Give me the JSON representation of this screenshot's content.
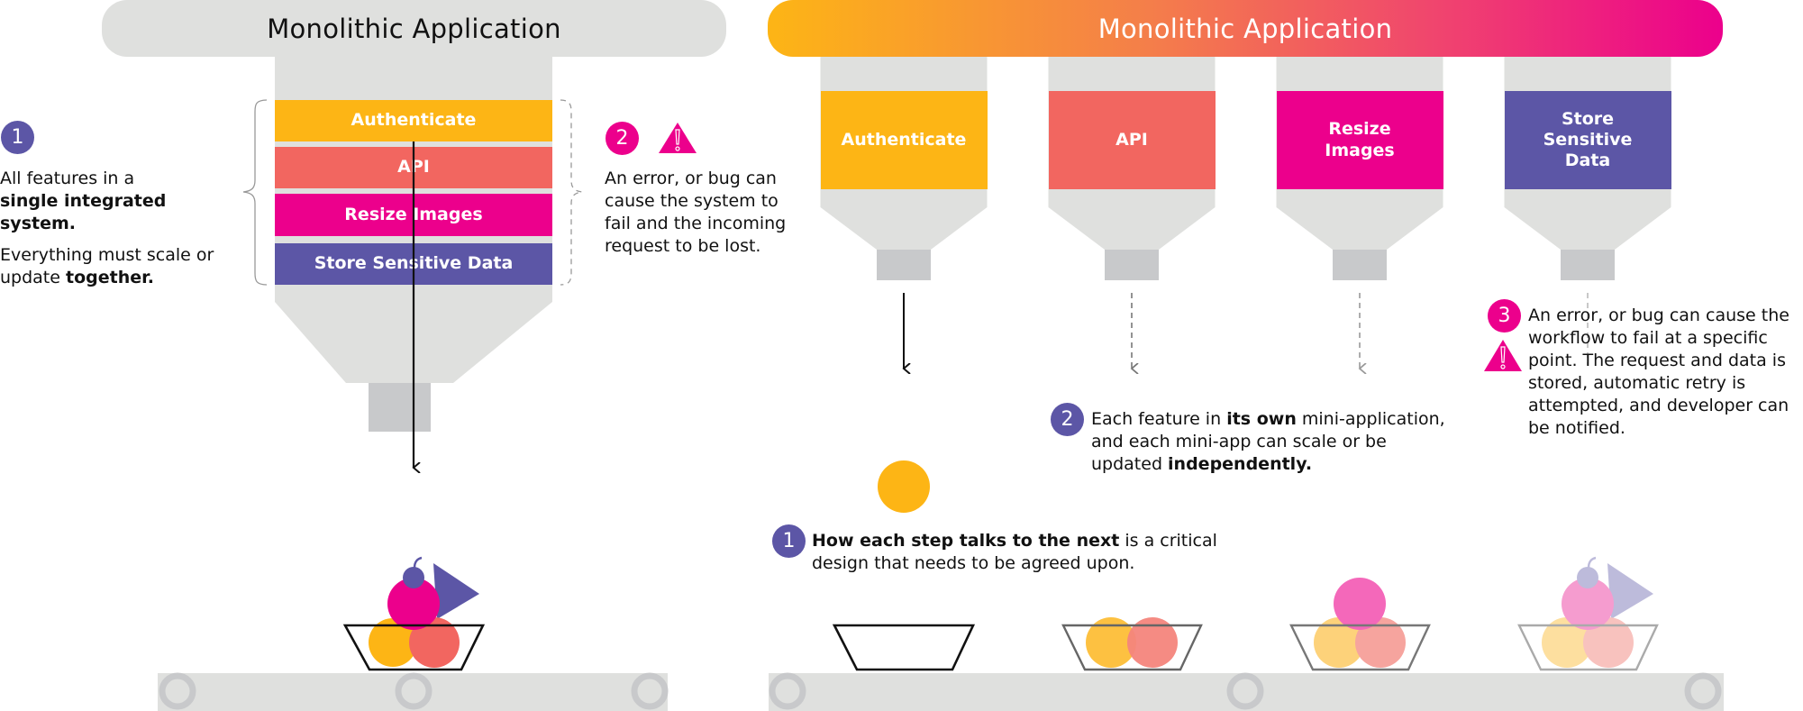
{
  "colors": {
    "grey_body": "#DFE0DE",
    "grey_nozzle": "#C8C9CB",
    "authenticate": "#FDB515",
    "api": "#F26660",
    "resize": "#EC008C",
    "store": "#5C56A6",
    "gradient_start": "#FDB515",
    "gradient_end": "#EC008C",
    "badge_purple": "#5C56A6",
    "badge_pink": "#EC008C"
  },
  "left": {
    "header": "Monolithic Application",
    "features": [
      "Authenticate",
      "API",
      "Resize Images",
      "Store Sensitive Data"
    ],
    "note1": {
      "badge": "1",
      "line1": "All features in a",
      "line2_bold": "single integrated system.",
      "line3": "Everything must scale or",
      "line4_prefix": "update ",
      "line4_bold": "together."
    },
    "note2": {
      "badge": "2",
      "icon": "warning-icon",
      "lines": [
        "An error, or bug can",
        "cause the system to",
        "fail and the incoming",
        "request to be lost."
      ]
    }
  },
  "right": {
    "header": "Monolithic Application",
    "features": [
      "Authenticate",
      "API",
      "Resize\nImages",
      "Store\nSensitive\nData"
    ],
    "note1": {
      "badge": "1",
      "bold": "How each step talks to the next",
      "rest": " is a critical",
      "line2": "design that needs to be agreed upon."
    },
    "note2": {
      "badge": "2",
      "line1_prefix": "Each feature in ",
      "line1_bold": "its own",
      "line1_suffix": " mini-application,",
      "line2": "and each mini-app can scale or be",
      "line3_prefix": "updated ",
      "line3_bold": "independently."
    },
    "note3": {
      "badge": "3",
      "icon": "warning-icon",
      "lines": [
        "An error, or bug can cause the",
        "workflow to fail at a specific",
        "point. The request and data is",
        "stored, automatic retry is",
        "attempted, and developer can",
        "be notified."
      ]
    }
  }
}
